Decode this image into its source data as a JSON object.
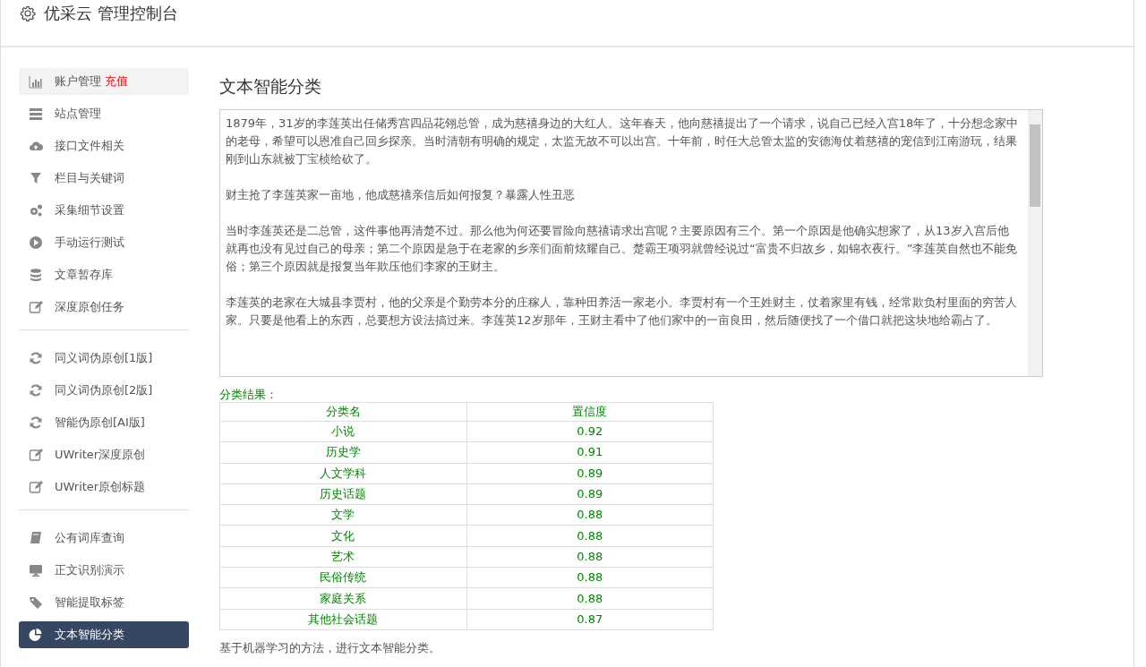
{
  "header": {
    "title": "优采云 管理控制台"
  },
  "sidebar": {
    "groups": [
      [
        {
          "label": "账户管理",
          "badge": "充值",
          "highlighted": true,
          "selected": false
        },
        {
          "label": "站点管理",
          "highlighted": false,
          "selected": false
        },
        {
          "label": "接口文件相关",
          "highlighted": false,
          "selected": false
        },
        {
          "label": "栏目与关键词",
          "highlighted": false,
          "selected": false
        },
        {
          "label": "采集细节设置",
          "highlighted": false,
          "selected": false
        },
        {
          "label": "手动运行测试",
          "highlighted": false,
          "selected": false
        },
        {
          "label": "文章暂存库",
          "highlighted": false,
          "selected": false
        },
        {
          "label": "深度原创任务",
          "highlighted": false,
          "selected": false
        }
      ],
      [
        {
          "label": "同义词伪原创[1版]",
          "highlighted": false,
          "selected": false
        },
        {
          "label": "同义词伪原创[2版]",
          "highlighted": false,
          "selected": false
        },
        {
          "label": "智能伪原创[AI版]",
          "highlighted": false,
          "selected": false
        },
        {
          "label": "UWriter深度原创",
          "highlighted": false,
          "selected": false
        },
        {
          "label": "UWriter原创标题",
          "highlighted": false,
          "selected": false
        }
      ],
      [
        {
          "label": "公有词库查询",
          "highlighted": false,
          "selected": false
        },
        {
          "label": "正文识别演示",
          "highlighted": false,
          "selected": false
        },
        {
          "label": "智能提取标签",
          "highlighted": false,
          "selected": false
        },
        {
          "label": "文本智能分类",
          "highlighted": false,
          "selected": true
        }
      ]
    ]
  },
  "main": {
    "title": "文本智能分类",
    "text_input": {
      "paragraphs": [
        "1879年，31岁的李莲英出任储秀宫四品花翎总管，成为慈禧身边的大红人。这年春天，他向慈禧提出了一个请求，说自己已经入宫18年了，十分想念家中的老母，希望可以恩准自己回乡探亲。当时清朝有明确的规定，太监无故不可以出宫。十年前，时任大总管太监的安德海仗着慈禧的宠信到江南游玩，结果刚到山东就被丁宝桢给砍了。",
        "财主抢了李莲英家一亩地，他成慈禧亲信后如何报复？暴露人性丑恶",
        "当时李莲英还是二总管，这件事他再清楚不过。那么他为何还要冒险向慈禧请求出宫呢？主要原因有三个。第一个原因是他确实想家了，从13岁入宫后他就再也没有见过自己的母亲；第二个原因是急于在老家的乡亲们面前炫耀自己。楚霸王项羽就曾经说过“富贵不归故乡，如锦衣夜行。”李莲英自然也不能免俗；第三个原因就是报复当年欺压他们李家的王财主。",
        "李莲英的老家在大城县李贾村，他的父亲是个勤劳本分的庄稼人，靠种田养活一家老小。李贾村有一个王姓财主，仗着家里有钱，经常欺负村里面的穷苦人家。只要是他看上的东西，总要想方设法搞过来。李莲英12岁那年，王财主看中了他们家中的一亩良田，然后随便找了一个借口就把这块地给霸占了。"
      ]
    },
    "result_label": "分类结果：",
    "table": {
      "columns": [
        "分类名",
        "置信度"
      ],
      "rows": [
        [
          "小说",
          "0.92"
        ],
        [
          "历史学",
          "0.91"
        ],
        [
          "人文学科",
          "0.89"
        ],
        [
          "历史话题",
          "0.89"
        ],
        [
          "文学",
          "0.88"
        ],
        [
          "文化",
          "0.88"
        ],
        [
          "艺术",
          "0.88"
        ],
        [
          "民俗传统",
          "0.88"
        ],
        [
          "家庭关系",
          "0.88"
        ],
        [
          "其他社会话题",
          "0.87"
        ]
      ]
    },
    "description": "基于机器学习的方法，进行文本智能分类。"
  }
}
